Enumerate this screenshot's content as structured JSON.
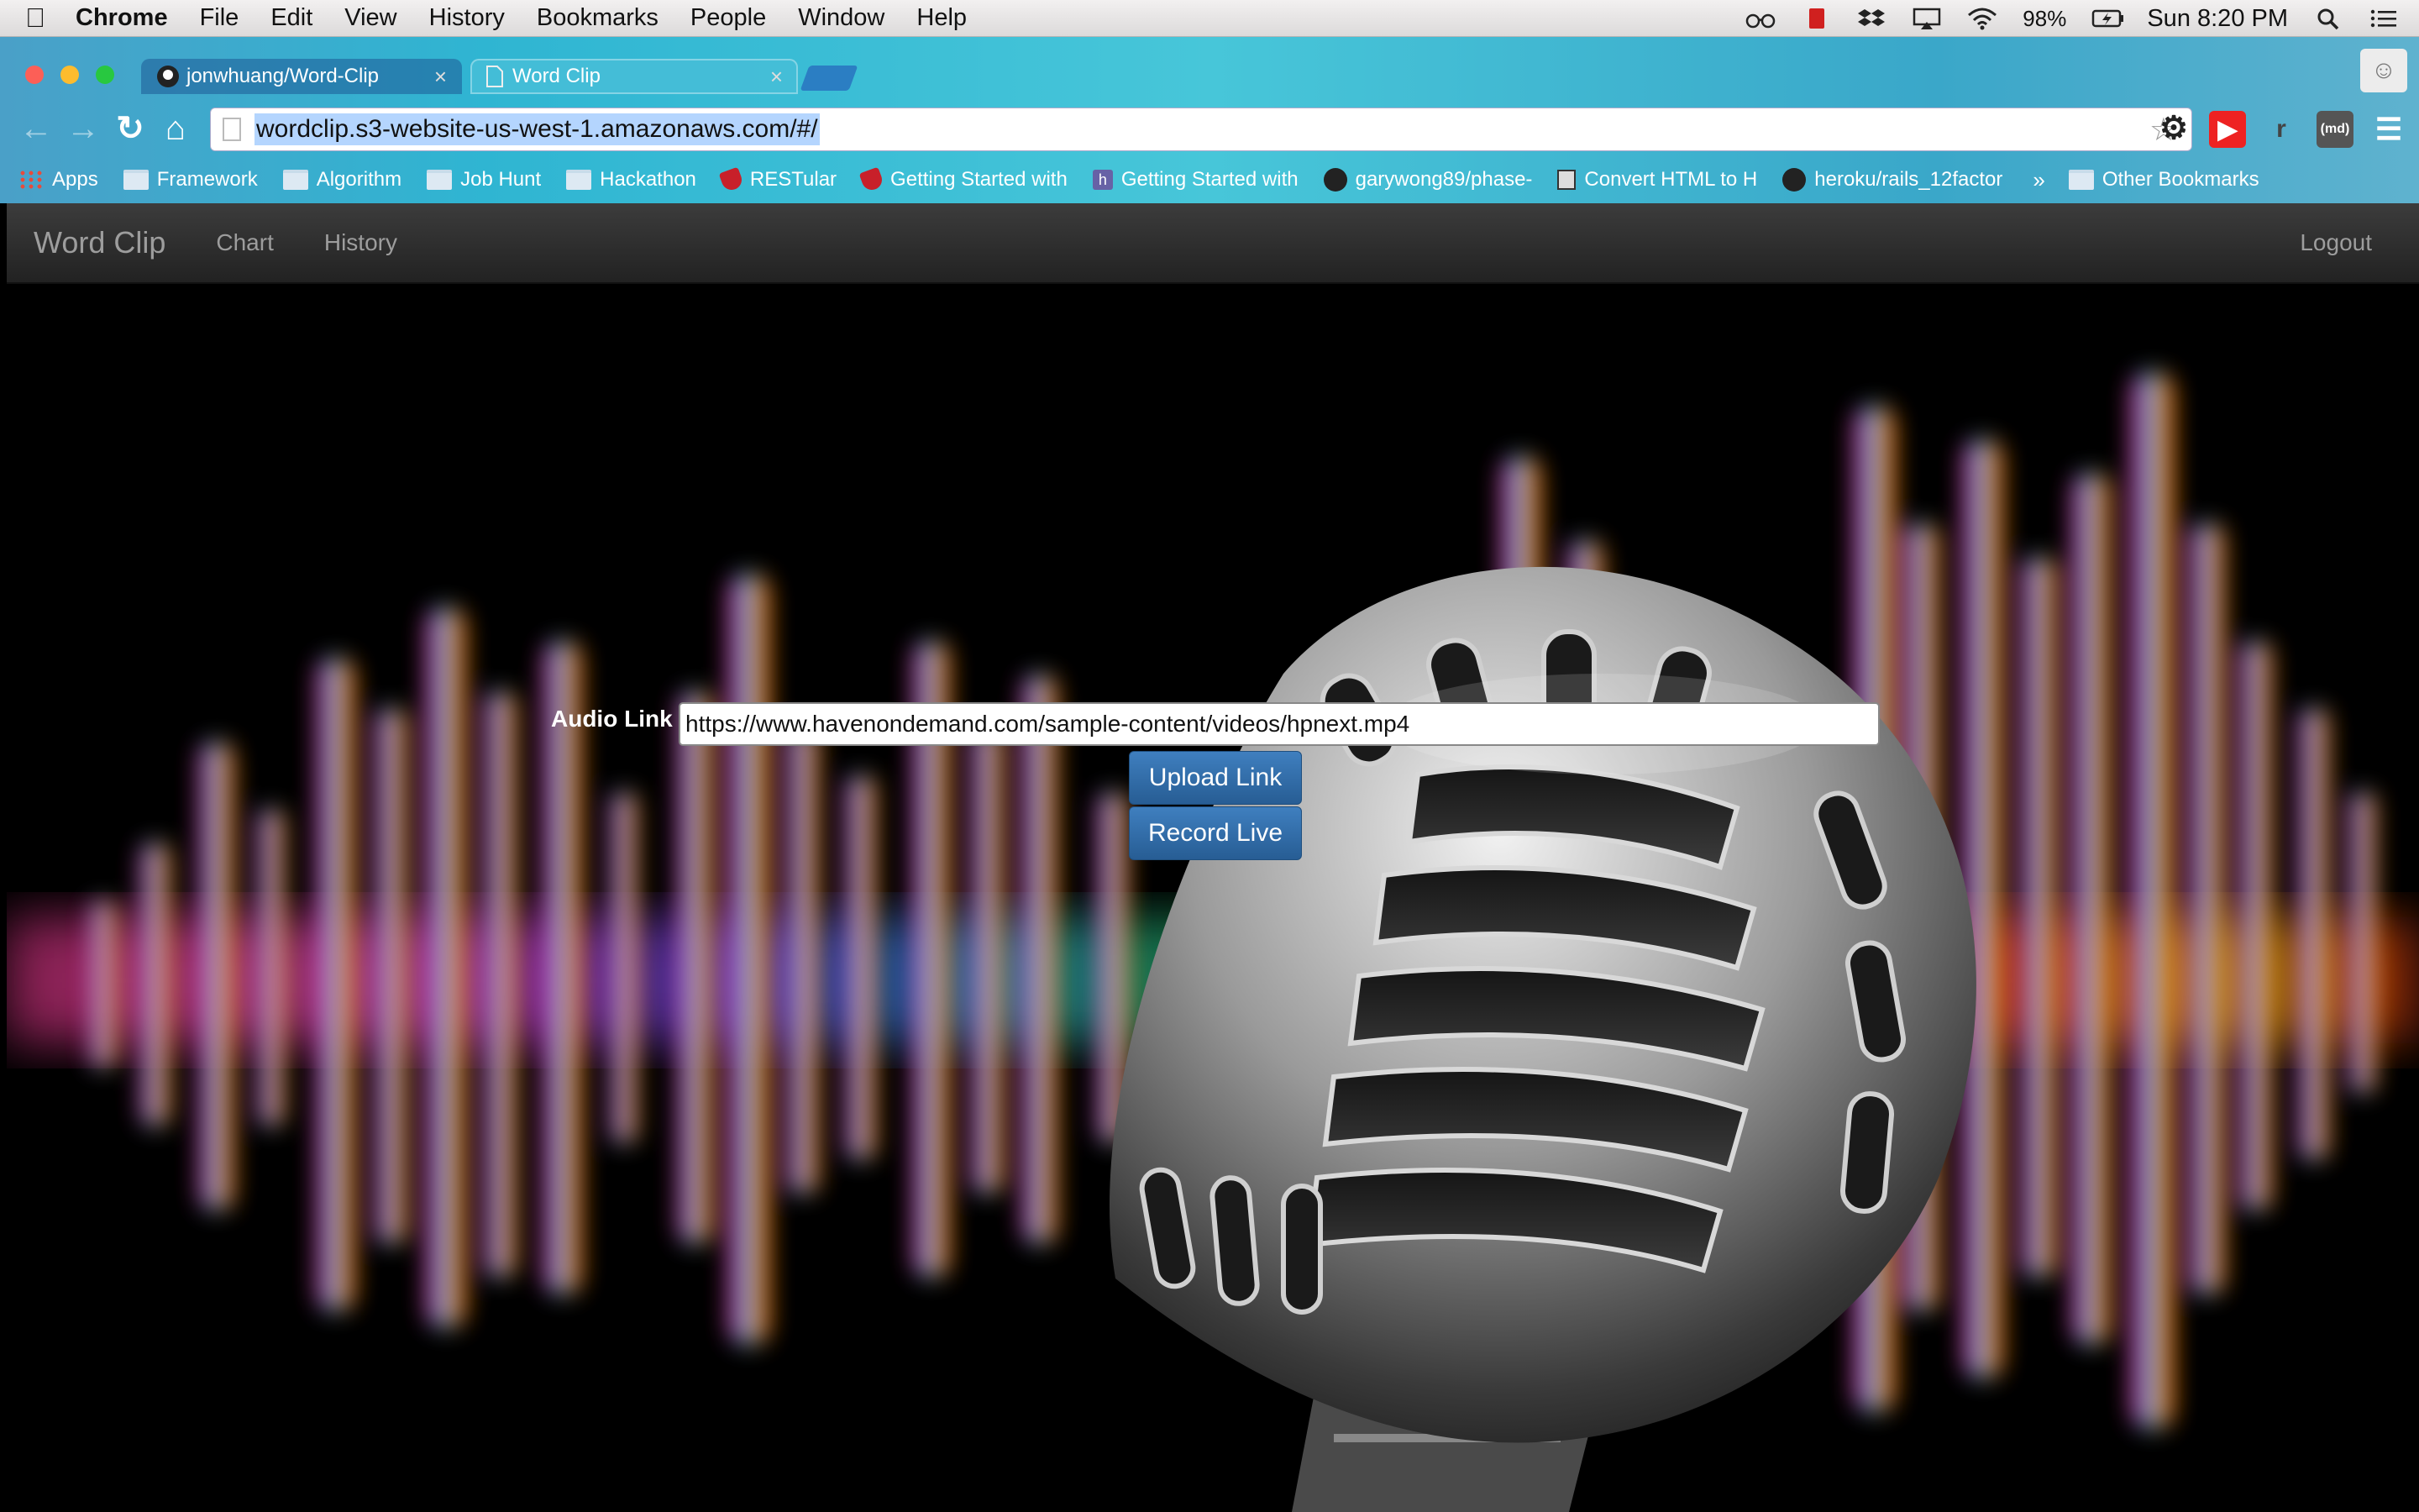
{
  "menubar": {
    "app": "Chrome",
    "items": [
      "File",
      "Edit",
      "View",
      "History",
      "Bookmarks",
      "People",
      "Window",
      "Help"
    ],
    "battery": "98%",
    "clock": "Sun 8:20 PM"
  },
  "tabs": [
    {
      "title": "jonwhuang/Word-Clip"
    },
    {
      "title": "Word Clip"
    }
  ],
  "omnibox": {
    "url": "wordclip.s3-website-us-west-1.amazonaws.com/#/"
  },
  "extensions": {
    "r_label": "r",
    "md_label": "(md)"
  },
  "bookmarks": {
    "items": [
      {
        "label": "Apps",
        "icon": "apps-grid-icon"
      },
      {
        "label": "Framework",
        "icon": "folder-icon"
      },
      {
        "label": "Algorithm",
        "icon": "folder-icon"
      },
      {
        "label": "Job Hunt",
        "icon": "folder-icon"
      },
      {
        "label": "Hackathon",
        "icon": "folder-icon"
      },
      {
        "label": "RESTular",
        "icon": "ruby-icon"
      },
      {
        "label": "Getting Started with",
        "icon": "ruby-icon"
      },
      {
        "label": "Getting Started with",
        "icon": "heroku-icon"
      },
      {
        "label": "garywong89/phase-",
        "icon": "github-icon"
      },
      {
        "label": "Convert HTML to H",
        "icon": "html-icon"
      },
      {
        "label": "heroku/rails_12factor",
        "icon": "github-icon"
      }
    ],
    "more": "»",
    "other": "Other Bookmarks"
  },
  "app": {
    "brand": "Word Clip",
    "nav": [
      "Chart",
      "History"
    ],
    "logout": "Logout"
  },
  "form": {
    "label": "Audio Link",
    "input_value": "https://www.havenondemand.com/sample-content/videos/hpnext.mp4",
    "upload_label": "Upload Link",
    "record_label": "Record Live"
  },
  "colors": {
    "accent": "#2f6ca6",
    "navbar": "#2b2b2b",
    "chrome_theme": "#2fb5d2"
  }
}
